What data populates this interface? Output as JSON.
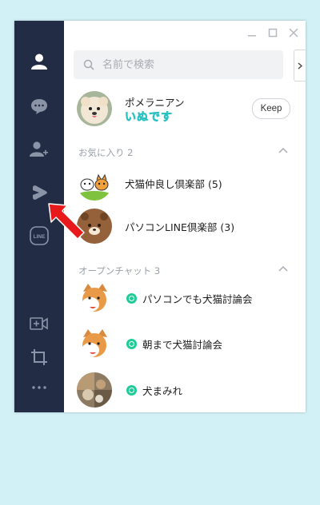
{
  "colors": {
    "sidebar": "#232c45",
    "background": "#d2f1f6",
    "openchat_accent": "#1fcc98",
    "arrow": "#e8191b"
  },
  "sidebar": {
    "items": [
      {
        "name": "friends-icon"
      },
      {
        "name": "chats-icon"
      },
      {
        "name": "add-friend-icon"
      },
      {
        "name": "share-icon"
      },
      {
        "name": "line-icon",
        "text": "LINE"
      },
      {
        "name": "video-add-icon"
      },
      {
        "name": "crop-icon"
      },
      {
        "name": "more-icon",
        "text": "···"
      }
    ]
  },
  "search": {
    "placeholder": "名前で検索"
  },
  "profile": {
    "name": "ポメラニアン",
    "status": "いぬです",
    "keep_label": "Keep"
  },
  "favorites": {
    "header": "お気に入り 2",
    "items": [
      {
        "name": "犬猫仲良し倶楽部 (5)"
      },
      {
        "name": "パソコンLINE倶楽部 (3)"
      }
    ]
  },
  "openchat": {
    "header": "オープンチャット 3",
    "items": [
      {
        "name": "パソコンでも犬猫討論会"
      },
      {
        "name": "朝まで犬猫討論会"
      },
      {
        "name": "犬まみれ"
      }
    ]
  }
}
